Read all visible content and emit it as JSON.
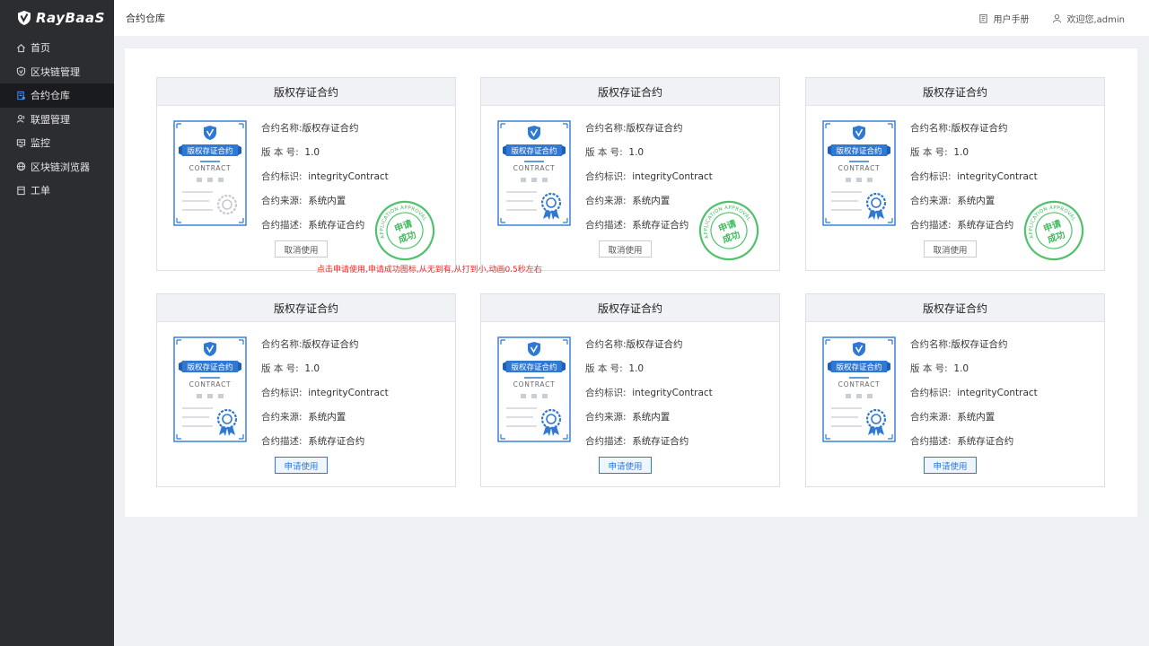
{
  "app": {
    "name": "RayBaaS"
  },
  "sidebar": {
    "items": [
      {
        "label": "首页",
        "icon": "home-icon",
        "active": false
      },
      {
        "label": "区块链管理",
        "icon": "shield-icon",
        "active": false
      },
      {
        "label": "合约仓库",
        "icon": "contract-icon",
        "active": true
      },
      {
        "label": "联盟管理",
        "icon": "users-icon",
        "active": false
      },
      {
        "label": "监控",
        "icon": "monitor-icon",
        "active": false
      },
      {
        "label": "区块链浏览器",
        "icon": "globe-icon",
        "active": false
      },
      {
        "label": "工单",
        "icon": "ticket-icon",
        "active": false
      }
    ]
  },
  "header": {
    "title": "合约仓库",
    "manual": "用户手册",
    "welcome": "欢迎您,admin"
  },
  "annotation": "点击申请使用,申请成功图标,从无到有,从打到小,动画0.5秒左右",
  "cards": [
    {
      "title": "版权存证合约",
      "name_label": "合约名称:",
      "name": "版权存证合约",
      "version_label": "版 本 号:",
      "version": "1.0",
      "id_label": "合约标识:",
      "id": "integrityContract",
      "source_label": "合约来源:",
      "source": "系统内置",
      "desc_label": "合约描述:",
      "desc": "系统存证合约",
      "cert_title": "版权存证合约",
      "cert_sub": "CONTRACT",
      "button": "取消使用",
      "applied": true,
      "stamp_text": "申请成功",
      "stamp_arc": "APPLICATION APPROVAL"
    },
    {
      "title": "版权存证合约",
      "name_label": "合约名称:",
      "name": "版权存证合约",
      "version_label": "版 本 号:",
      "version": "1.0",
      "id_label": "合约标识:",
      "id": "integrityContract",
      "source_label": "合约来源:",
      "source": "系统内置",
      "desc_label": "合约描述:",
      "desc": "系统存证合约",
      "cert_title": "版权存证合约",
      "cert_sub": "CONTRACT",
      "button": "取消使用",
      "applied": true,
      "stamp_text": "申请成功",
      "stamp_arc": "APPLICATION APPROVAL"
    },
    {
      "title": "版权存证合约",
      "name_label": "合约名称:",
      "name": "版权存证合约",
      "version_label": "版 本 号:",
      "version": "1.0",
      "id_label": "合约标识:",
      "id": "integrityContract",
      "source_label": "合约来源:",
      "source": "系统内置",
      "desc_label": "合约描述:",
      "desc": "系统存证合约",
      "cert_title": "版权存证合约",
      "cert_sub": "CONTRACT",
      "button": "取消使用",
      "applied": true,
      "stamp_text": "申请成功",
      "stamp_arc": "APPLICATION APPROVAL"
    },
    {
      "title": "版权存证合约",
      "name_label": "合约名称:",
      "name": "版权存证合约",
      "version_label": "版 本 号:",
      "version": "1.0",
      "id_label": "合约标识:",
      "id": "integrityContract",
      "source_label": "合约来源:",
      "source": "系统内置",
      "desc_label": "合约描述:",
      "desc": "系统存证合约",
      "cert_title": "版权存证合约",
      "cert_sub": "CONTRACT",
      "button": "申请使用",
      "applied": false
    },
    {
      "title": "版权存证合约",
      "name_label": "合约名称:",
      "name": "版权存证合约",
      "version_label": "版 本 号:",
      "version": "1.0",
      "id_label": "合约标识:",
      "id": "integrityContract",
      "source_label": "合约来源:",
      "source": "系统内置",
      "desc_label": "合约描述:",
      "desc": "系统存证合约",
      "cert_title": "版权存证合约",
      "cert_sub": "CONTRACT",
      "button": "申请使用",
      "applied": false
    },
    {
      "title": "版权存证合约",
      "name_label": "合约名称:",
      "name": "版权存证合约",
      "version_label": "版 本 号:",
      "version": "1.0",
      "id_label": "合约标识:",
      "id": "integrityContract",
      "source_label": "合约来源:",
      "source": "系统内置",
      "desc_label": "合约描述:",
      "desc": "系统存证合约",
      "cert_title": "版权存证合约",
      "cert_sub": "CONTRACT",
      "button": "申请使用",
      "applied": false
    }
  ],
  "colors": {
    "accent": "#2f78d4",
    "stamp": "#3dbb5c",
    "sidebar": "#2b2d31",
    "note": "#e0302c"
  }
}
